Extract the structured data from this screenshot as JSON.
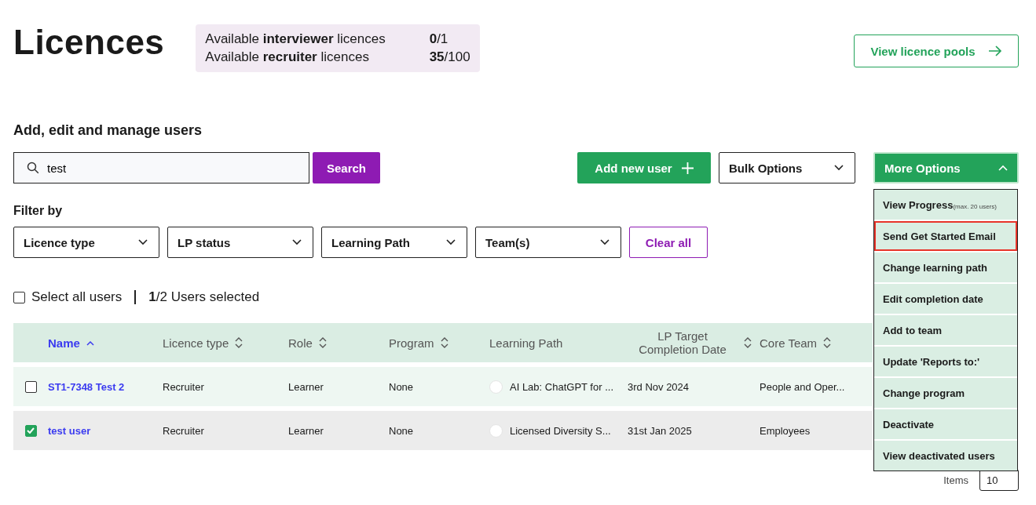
{
  "page_title": "Licences",
  "licence_summary": [
    {
      "before": "Available ",
      "bold": "interviewer",
      "after": " licences",
      "used": "0",
      "total": "/1"
    },
    {
      "before": "Available ",
      "bold": "recruiter",
      "after": " licences",
      "used": "35",
      "total": "/100"
    }
  ],
  "view_pools_button": "View licence pools",
  "section_title": "Add, edit and manage users",
  "search": {
    "value": "test",
    "button": "Search"
  },
  "add_user_button": "Add new user",
  "bulk_options": "Bulk Options",
  "more_options": {
    "label": "More Options",
    "expanded": true,
    "items": [
      {
        "label": "View Progress",
        "note": "(max. 20 users)",
        "highlighted": false
      },
      {
        "label": "Send Get Started Email",
        "highlighted": true
      },
      {
        "label": "Change learning path",
        "highlighted": false
      },
      {
        "label": "Edit completion date",
        "highlighted": false
      },
      {
        "label": "Add to team",
        "highlighted": false
      },
      {
        "label": "Update 'Reports to:'",
        "highlighted": false
      },
      {
        "label": "Change program",
        "highlighted": false
      },
      {
        "label": "Deactivate",
        "highlighted": false
      },
      {
        "label": "View deactivated users",
        "highlighted": false
      }
    ]
  },
  "filter_label": "Filter by",
  "filters": [
    "Licence type",
    "LP status",
    "Learning Path",
    "Team(s)"
  ],
  "clear_all": "Clear all",
  "select_all": {
    "label": "Select all users",
    "checked": false,
    "count_bold": "1",
    "count_rest": "/2 Users selected"
  },
  "table": {
    "columns": [
      {
        "label": "Name",
        "sortable": true,
        "sorted": true
      },
      {
        "label": "Licence type",
        "sortable": true,
        "sorted": false
      },
      {
        "label": "Role",
        "sortable": true,
        "sorted": false
      },
      {
        "label": "Program",
        "sortable": true,
        "sorted": false
      },
      {
        "label": "Learning Path",
        "sortable": false,
        "sorted": false
      },
      {
        "label": "LP Target Completion Date",
        "sortable": true,
        "sorted": false
      },
      {
        "label": "Core Team",
        "sortable": true,
        "sorted": false
      }
    ],
    "rows": [
      {
        "selected": false,
        "name": "ST1-7348 Test 2",
        "licence_type": "Recruiter",
        "role": "Learner",
        "program": "None",
        "learning_path": "AI Lab: ChatGPT for ...",
        "target_date": "3rd Nov 2024",
        "core_team": "People and Oper..."
      },
      {
        "selected": true,
        "name": "test user",
        "licence_type": "Recruiter",
        "role": "Learner",
        "program": "None",
        "learning_path": "Licensed Diversity S...",
        "target_date": "31st Jan 2025",
        "core_team": "Employees"
      }
    ]
  },
  "pagination": {
    "items_label": "Items",
    "page_size": "10"
  }
}
